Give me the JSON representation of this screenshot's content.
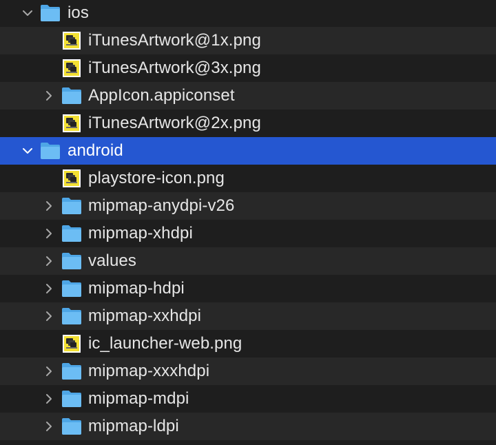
{
  "tree": [
    {
      "label": "ios",
      "type": "folder",
      "level": 0,
      "expanded": true,
      "selected": false
    },
    {
      "label": "iTunesArtwork@1x.png",
      "type": "file",
      "level": 1,
      "selected": false
    },
    {
      "label": "iTunesArtwork@3x.png",
      "type": "file",
      "level": 1,
      "selected": false
    },
    {
      "label": "AppIcon.appiconset",
      "type": "folder",
      "level": 1,
      "expanded": false,
      "selected": false
    },
    {
      "label": "iTunesArtwork@2x.png",
      "type": "file",
      "level": 1,
      "selected": false
    },
    {
      "label": "android",
      "type": "folder",
      "level": 0,
      "expanded": true,
      "selected": true
    },
    {
      "label": "playstore-icon.png",
      "type": "file",
      "level": 1,
      "selected": false
    },
    {
      "label": "mipmap-anydpi-v26",
      "type": "folder",
      "level": 1,
      "expanded": false,
      "selected": false
    },
    {
      "label": "mipmap-xhdpi",
      "type": "folder",
      "level": 1,
      "expanded": false,
      "selected": false
    },
    {
      "label": "values",
      "type": "folder",
      "level": 1,
      "expanded": false,
      "selected": false
    },
    {
      "label": "mipmap-hdpi",
      "type": "folder",
      "level": 1,
      "expanded": false,
      "selected": false
    },
    {
      "label": "mipmap-xxhdpi",
      "type": "folder",
      "level": 1,
      "expanded": false,
      "selected": false
    },
    {
      "label": "ic_launcher-web.png",
      "type": "file",
      "level": 1,
      "selected": false
    },
    {
      "label": "mipmap-xxxhdpi",
      "type": "folder",
      "level": 1,
      "expanded": false,
      "selected": false
    },
    {
      "label": "mipmap-mdpi",
      "type": "folder",
      "level": 1,
      "expanded": false,
      "selected": false
    },
    {
      "label": "mipmap-ldpi",
      "type": "folder",
      "level": 1,
      "expanded": false,
      "selected": false
    }
  ],
  "colors": {
    "background": "#1e1e1e",
    "row_alt": "#282828",
    "selection": "#2557d1",
    "folder": "#5fb4f0",
    "text": "#e6e6e6"
  },
  "icons": {
    "folder": "folder-icon",
    "file": "png-file-icon",
    "collapsed": "chevron-right-icon",
    "expanded": "chevron-down-icon"
  }
}
